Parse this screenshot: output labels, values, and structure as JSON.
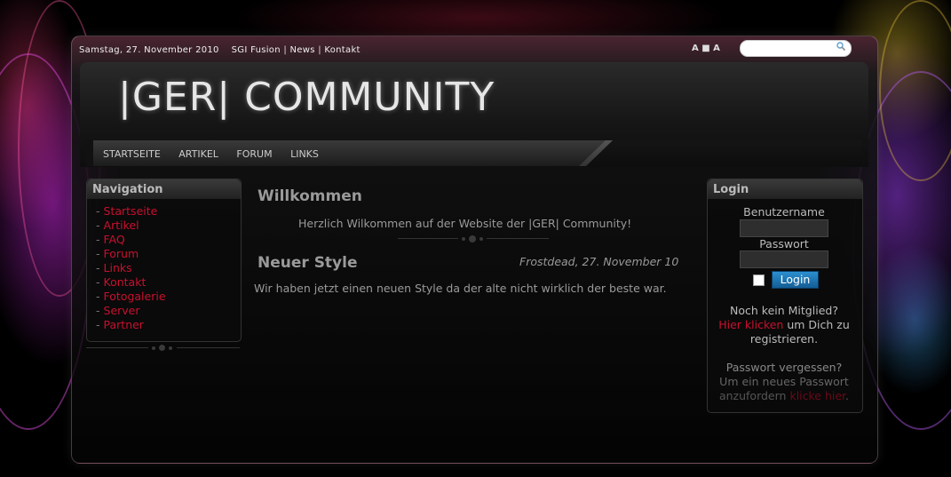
{
  "topbar": {
    "date": "Samstag, 27. November 2010",
    "links": [
      "SGI Fusion",
      "News",
      "Kontakt"
    ],
    "font_controls": "A ■ A"
  },
  "search": {
    "placeholder": "",
    "icon": "search-icon"
  },
  "logo": "|GER| COMMUNITY",
  "nav": {
    "items": [
      "STARTSEITE",
      "ARTIKEL",
      "FORUM",
      "LINKS"
    ]
  },
  "sidebar": {
    "title": "Navigation",
    "items": [
      "Startseite",
      "Artikel",
      "FAQ",
      "Forum",
      "Links",
      "Kontakt",
      "Fotogalerie",
      "Server",
      "Partner"
    ]
  },
  "main": {
    "welcome_title": "Willkommen",
    "welcome_text": "Herzlich Wilkommen auf der Website der |GER| Community!",
    "news": {
      "title": "Neuer Style",
      "meta": "Frostdead, 27. November 10",
      "body": "Wir haben jetzt einen neuen Style da der alte nicht wirklich der beste war."
    }
  },
  "login": {
    "title": "Login",
    "username_label": "Benutzername",
    "password_label": "Passwort",
    "button": "Login",
    "register_q": "Noch kein Mitglied?",
    "register_link": "Hier klicken",
    "register_rest1": "um Dich zu",
    "register_rest2": "registrieren.",
    "forgot_q": "Passwort vergessen?",
    "forgot_text1": "Um ein neues Passwort",
    "forgot_text2": "anzufordern",
    "forgot_link": "klicke hier",
    "forgot_end": "."
  },
  "colors": {
    "accent_red": "#c8102e",
    "button_blue": "#1f7bbd"
  }
}
